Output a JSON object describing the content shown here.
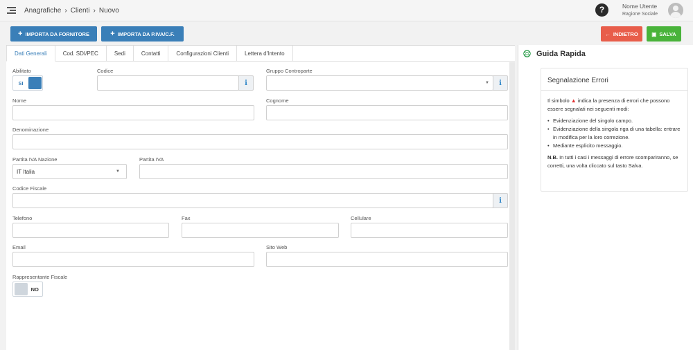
{
  "breadcrumb": [
    "Anagrafiche",
    "Clienti",
    "Nuovo"
  ],
  "user": {
    "name": "Nome Utente",
    "company": "Ragione Sociale"
  },
  "buttons": {
    "import_supplier": "IMPORTA DA FORNITORE",
    "import_vat": "IMPORTA DA P.IVA/C.F.",
    "back": "INDIETRO",
    "save": "SALVA"
  },
  "tabs": [
    "Dati Generali",
    "Cod. SDI/PEC",
    "Sedi",
    "Contatti",
    "Configurazioni Clienti",
    "Lettera d'Intento"
  ],
  "form": {
    "abilitato": {
      "label": "Abilitato",
      "value": "SI"
    },
    "codice": {
      "label": "Codice",
      "value": ""
    },
    "gruppo": {
      "label": "Gruppo Controparte",
      "value": ""
    },
    "nome": {
      "label": "Nome",
      "value": ""
    },
    "cognome": {
      "label": "Cognome",
      "value": ""
    },
    "denominazione": {
      "label": "Denominazione",
      "value": ""
    },
    "piva_nazione": {
      "label": "Partita IVA Nazione",
      "value": "IT Italia"
    },
    "piva": {
      "label": "Partita IVA",
      "value": ""
    },
    "codice_fiscale": {
      "label": "Codice Fiscale",
      "value": ""
    },
    "telefono": {
      "label": "Telefono",
      "value": ""
    },
    "fax": {
      "label": "Fax",
      "value": ""
    },
    "cellulare": {
      "label": "Cellulare",
      "value": ""
    },
    "email": {
      "label": "Email",
      "value": ""
    },
    "sito_web": {
      "label": "Sito Web",
      "value": ""
    },
    "rappresentante": {
      "label": "Rappresentante Fiscale",
      "value": "NO"
    }
  },
  "guide": {
    "title": "Guida Rapida",
    "box_title": "Segnalazione Errori",
    "intro_before": "Il simbolo",
    "intro_after": "indica la presenza di errori che possono essere segnalati nei seguenti modi:",
    "items": [
      "Evidenziazione del singolo campo.",
      "Evidenziazione della singola riga di una tabella: entrare in modifica per la loro correzione.",
      "Mediante esplicito messaggio."
    ],
    "nb_label": "N.B.",
    "nb_text": "In tutti i casi i messaggi di errore scompariranno, se corretti, una volta cliccato sul tasto Salva."
  },
  "colors": {
    "primary": "#3a7fb8",
    "danger": "#e85d4a",
    "success": "#49b33a"
  },
  "icons": [
    "menu-icon",
    "question-icon",
    "user-avatar-icon",
    "plus-icon",
    "arrow-left-icon",
    "save-icon",
    "info-icon",
    "lifebuoy-icon",
    "warning-icon"
  ]
}
